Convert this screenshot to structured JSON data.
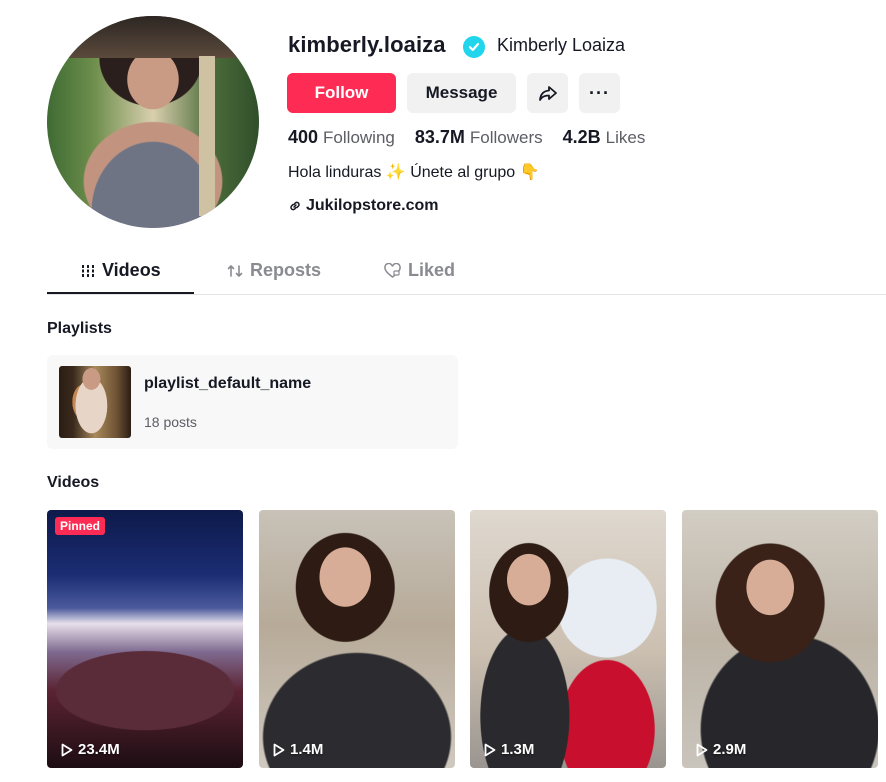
{
  "profile": {
    "username": "kimberly.loaiza",
    "display_name": "Kimberly Loaiza",
    "verified": true,
    "avatar_icon": "avatar-photo"
  },
  "actions": {
    "follow_label": "Follow",
    "message_label": "Message",
    "share_icon": "share-arrow-icon",
    "more_icon": "more-dots-icon",
    "more_label": "···"
  },
  "stats": {
    "following_value": "400",
    "following_label": "Following",
    "followers_value": "83.7M",
    "followers_label": "Followers",
    "likes_value": "4.2B",
    "likes_label": "Likes"
  },
  "bio": {
    "text": "Hola linduras ✨ Únete al grupo 👇",
    "link": "Jukilopstore.com"
  },
  "tabs": [
    {
      "label": "Videos",
      "icon": "grid-lines-icon",
      "active": true
    },
    {
      "label": "Reposts",
      "icon": "repost-icon",
      "active": false
    },
    {
      "label": "Liked",
      "icon": "heart-outline-icon",
      "active": false
    }
  ],
  "playlists": {
    "section_title": "Playlists",
    "items": [
      {
        "name": "playlist_default_name",
        "count": "18 posts"
      }
    ]
  },
  "videos": {
    "section_title": "Videos",
    "items": [
      {
        "views": "23.4M",
        "pinned_label": "Pinned"
      },
      {
        "views": "1.4M"
      },
      {
        "views": "1.3M"
      },
      {
        "views": "2.9M"
      }
    ]
  },
  "colors": {
    "accent": "#fe2c55",
    "verified": "#20d5ec",
    "text_primary": "#161823",
    "text_secondary": "#5c5d65",
    "button_bg": "#f1f1f2"
  }
}
